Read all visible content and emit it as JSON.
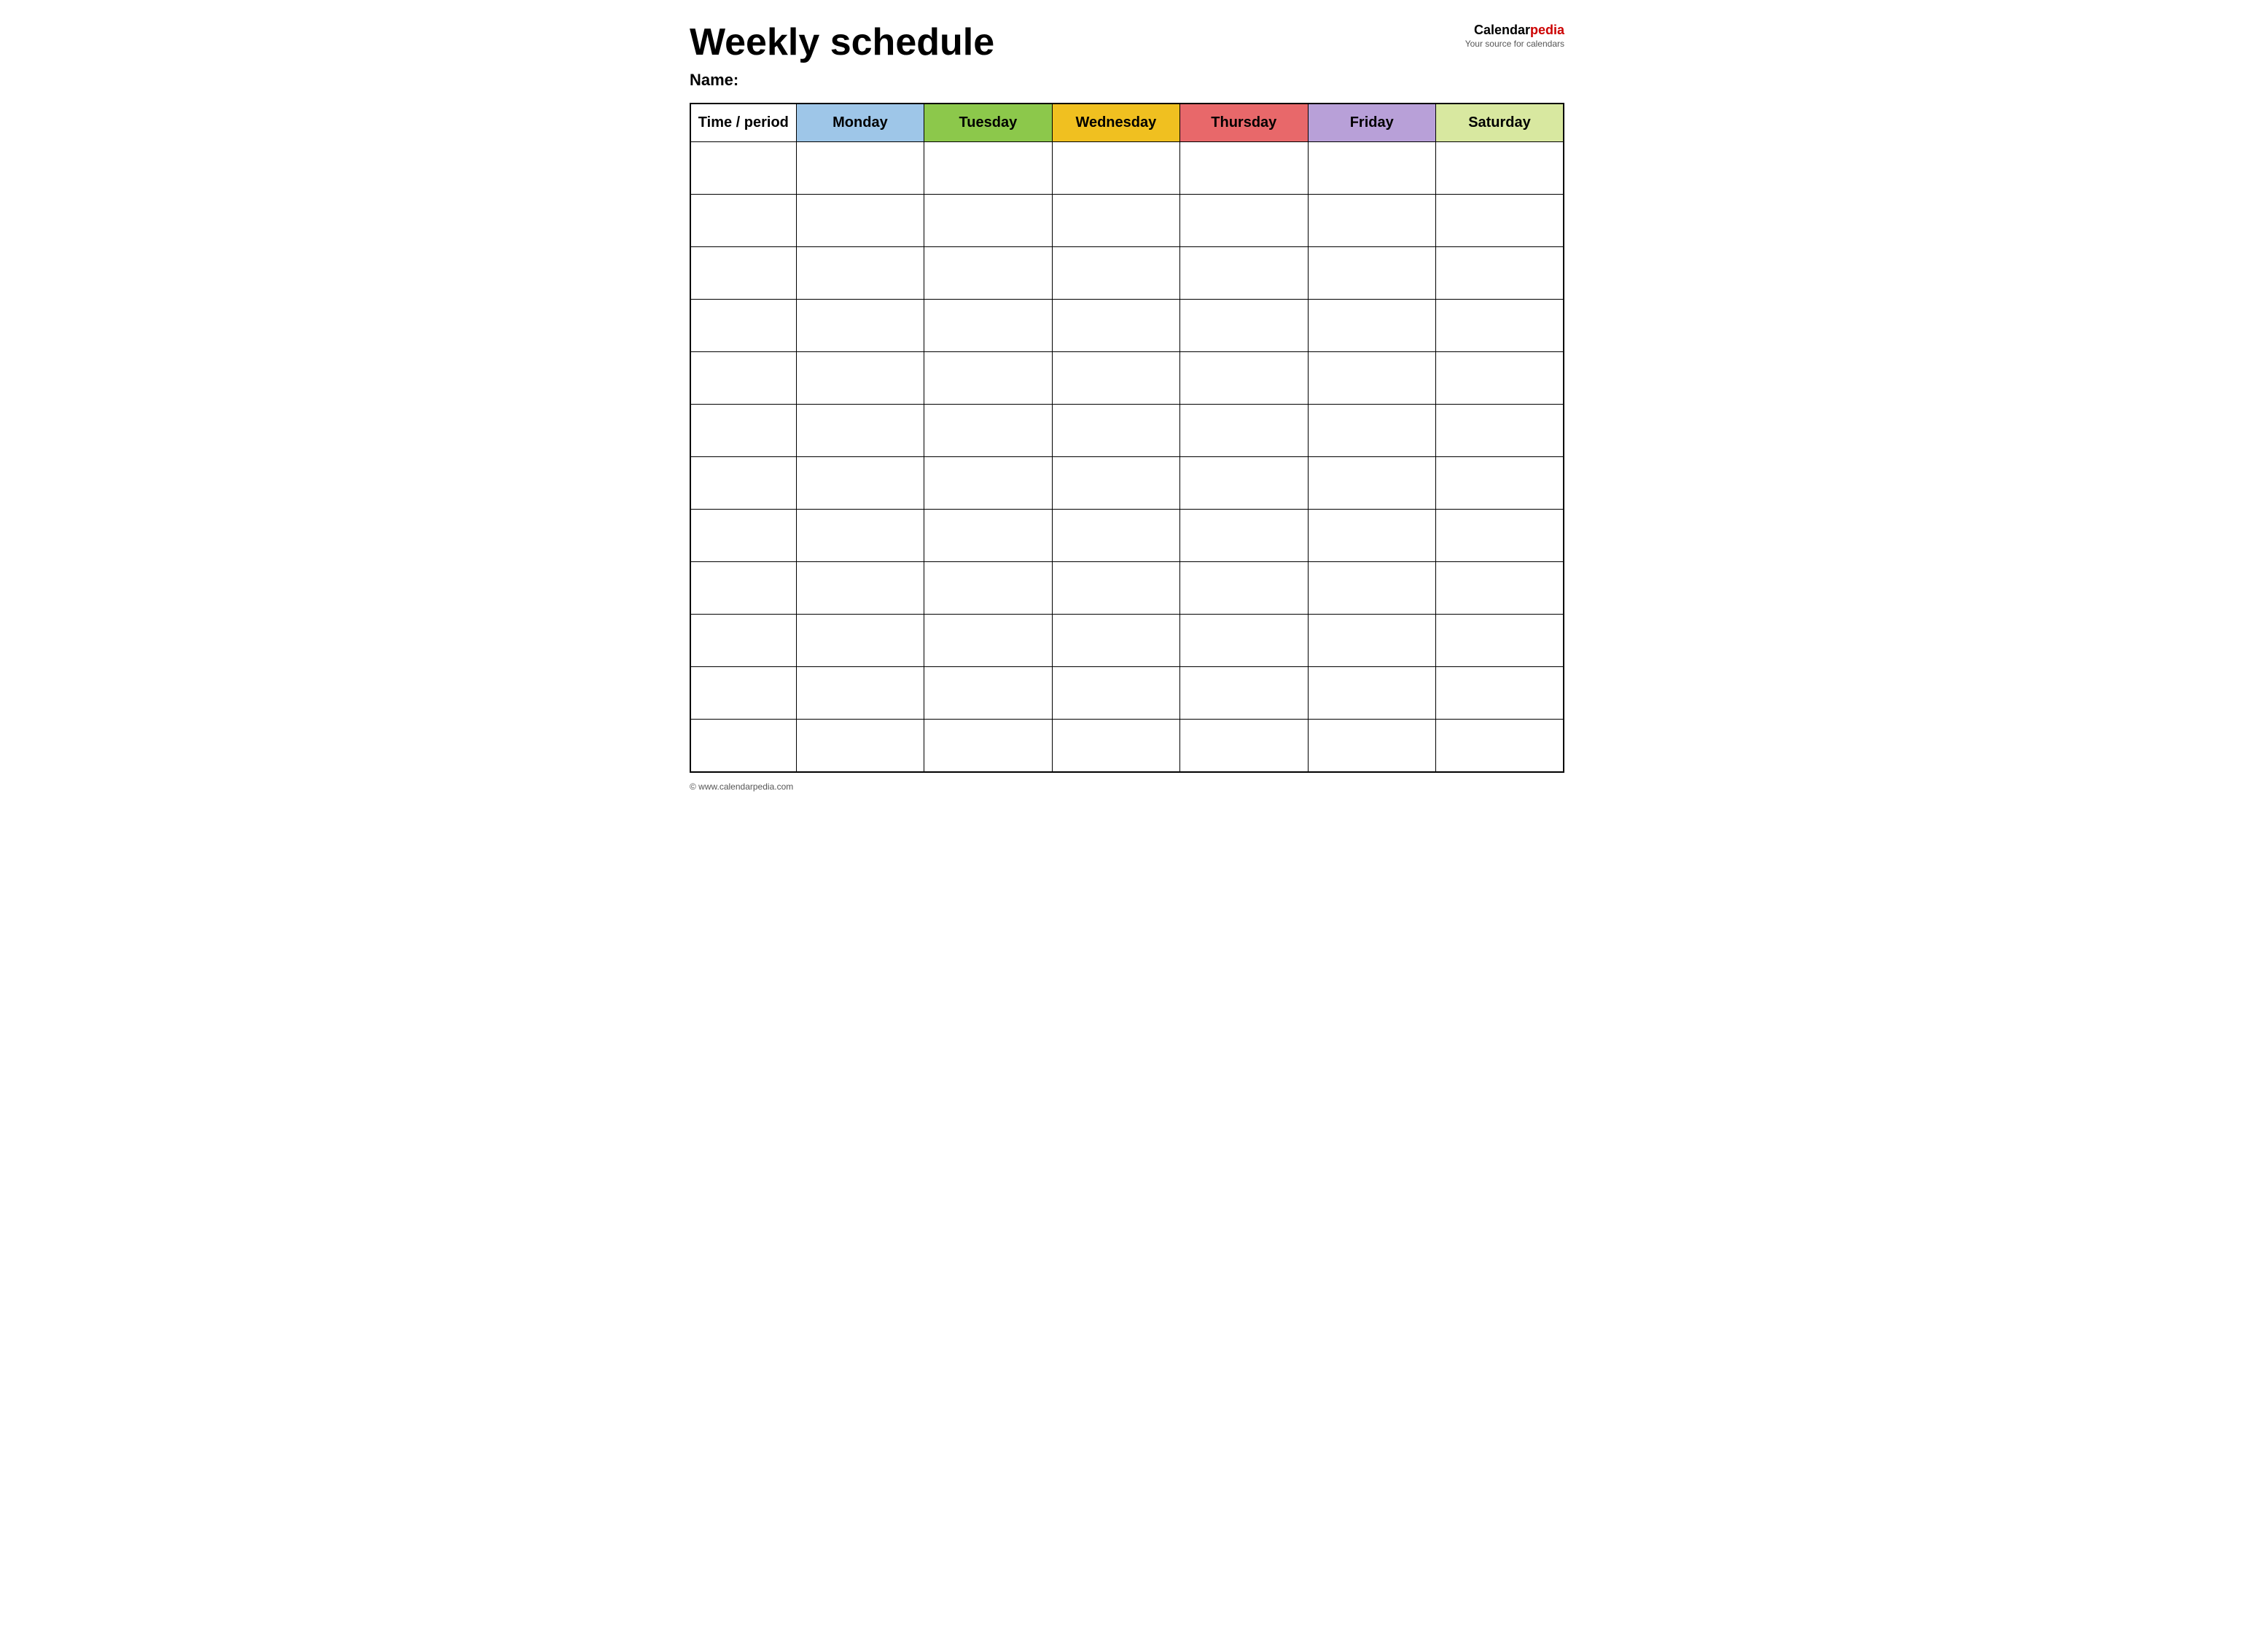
{
  "header": {
    "title": "Weekly schedule",
    "brand": {
      "name_part1": "Calendar",
      "name_part2": "pedia",
      "tagline": "Your source for calendars"
    },
    "name_label": "Name:"
  },
  "table": {
    "columns": [
      {
        "id": "time",
        "label": "Time / period",
        "class": "th-time"
      },
      {
        "id": "monday",
        "label": "Monday",
        "class": "th-monday"
      },
      {
        "id": "tuesday",
        "label": "Tuesday",
        "class": "th-tuesday"
      },
      {
        "id": "wednesday",
        "label": "Wednesday",
        "class": "th-wednesday"
      },
      {
        "id": "thursday",
        "label": "Thursday",
        "class": "th-thursday"
      },
      {
        "id": "friday",
        "label": "Friday",
        "class": "th-friday"
      },
      {
        "id": "saturday",
        "label": "Saturday",
        "class": "th-saturday"
      }
    ],
    "rows": 12
  },
  "footer": {
    "url": "© www.calendarpedia.com"
  }
}
